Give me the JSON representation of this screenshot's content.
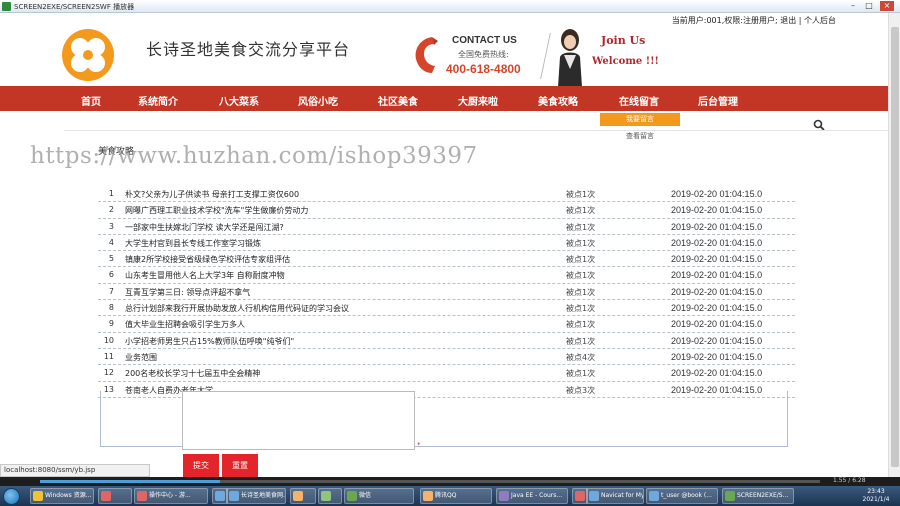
{
  "window": {
    "title": "SCREEN2EXE/SCREEN2SWF 播放器",
    "minimize": "–",
    "maximize": "□",
    "close": "×"
  },
  "user_bar": "当前用户:001,权限:注册用户; 退出 | 个人后台",
  "site_title": "长诗圣地美食交流分享平台",
  "contact": {
    "heading": "CONTACT US",
    "sub": "全国免费热线:",
    "phone": "400-618-4800"
  },
  "promo": {
    "line1": "Join Us",
    "line2": "Welcome !!!"
  },
  "nav": [
    "首页",
    "系统简介",
    "八大菜系",
    "风俗小吃",
    "社区美食",
    "大厨来啦",
    "美食攻略",
    "在线留言",
    "后台管理"
  ],
  "submenu": [
    "我要留言",
    "查看留言"
  ],
  "section_title": "美食攻略",
  "watermark": "https://www.huzhan.com/ishop39397",
  "articles": [
    {
      "num": "1",
      "title": "朴文?父亲为儿子供读书 母亲打工支撑工资仅600",
      "clicks": "被点1次",
      "date": "2019-02-20 01:04:15.0"
    },
    {
      "num": "2",
      "title": "网曝广西理工职业技术学校\"洗车\"学生做廉价劳动力",
      "clicks": "被点1次",
      "date": "2019-02-20 01:04:15.0"
    },
    {
      "num": "3",
      "title": "一部家中生扶嫁北门学校 读大学还是闯江湖?",
      "clicks": "被点1次",
      "date": "2019-02-20 01:04:15.0"
    },
    {
      "num": "4",
      "title": "大学生村官到县长专线工作室学习锻炼",
      "clicks": "被点1次",
      "date": "2019-02-20 01:04:15.0"
    },
    {
      "num": "5",
      "title": "镇康2所学校接受省级绿色学校评估专家组评估",
      "clicks": "被点1次",
      "date": "2019-02-20 01:04:15.0"
    },
    {
      "num": "6",
      "title": "山东考生冒用他人名上大学3年 自称耐度冲物",
      "clicks": "被点1次",
      "date": "2019-02-20 01:04:15.0"
    },
    {
      "num": "7",
      "title": "互青互学第三日: 领导点评超不拿气",
      "clicks": "被点1次",
      "date": "2019-02-20 01:04:15.0"
    },
    {
      "num": "8",
      "title": "总行计划部来我行开展协助发放人行机构信用代码证的学习会议",
      "clicks": "被点1次",
      "date": "2019-02-20 01:04:15.0"
    },
    {
      "num": "9",
      "title": "值大毕业生招聘会吸引学生万多人",
      "clicks": "被点1次",
      "date": "2019-02-20 01:04:15.0"
    },
    {
      "num": "10",
      "title": "小学招老师男生只占15%教师队伍呼唤\"纯爷们\"",
      "clicks": "被点1次",
      "date": "2019-02-20 01:04:15.0"
    },
    {
      "num": "11",
      "title": "业务范围",
      "clicks": "被点4次",
      "date": "2019-02-20 01:04:15.0"
    },
    {
      "num": "12",
      "title": "200名老校长学习十七届五中全会精神",
      "clicks": "被点1次",
      "date": "2019-02-20 01:04:15.0"
    },
    {
      "num": "13",
      "title": "苍南老人自费办老年大学",
      "clicks": "被点3次",
      "date": "2019-02-20 01:04:15.0"
    }
  ],
  "form": {
    "required": "*",
    "submit": "提交",
    "reset": "重置"
  },
  "status_url": "localhost:8080/ssm/yb.jsp",
  "player_time": "1.55 / 6.28",
  "taskbar": [
    {
      "label": "Windows 资源...",
      "color": "#f1c232"
    },
    {
      "label": "",
      "color": "#e06666"
    },
    {
      "label": "操作中心 - 游...",
      "color": "#e06666"
    },
    {
      "label": "",
      "color": "#6fa8dc"
    },
    {
      "label": "长诗圣地美食网...",
      "color": "#6fa8dc"
    },
    {
      "label": "",
      "color": "#f6b26b"
    },
    {
      "label": "",
      "color": "#93c47d"
    },
    {
      "label": "微信",
      "color": "#6aa84f"
    },
    {
      "label": "腾讯QQ",
      "color": "#f6b26b"
    },
    {
      "label": "Java EE - Cours...",
      "color": "#8e7cc3"
    },
    {
      "label": "",
      "color": "#e06666"
    },
    {
      "label": "Navicat for MyS...",
      "color": "#6fa8dc"
    },
    {
      "label": "t_user @book (...",
      "color": "#6fa8dc"
    },
    {
      "label": "SCREEN2EXE/S...",
      "color": "#6aa84f"
    }
  ],
  "clock": {
    "time": "23:43",
    "date": "2021/1/4"
  },
  "colors": {
    "nav": "#c33524",
    "accent": "#f39a1c",
    "button": "#e3252b",
    "phone": "#d6452a"
  }
}
